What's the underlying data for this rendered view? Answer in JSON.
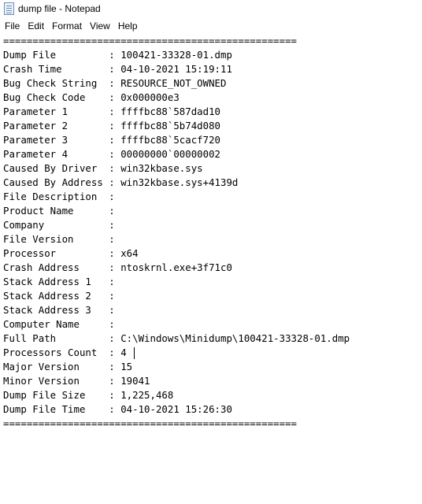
{
  "window": {
    "title": "dump file - Notepad",
    "icon": "notepad-icon"
  },
  "menu": {
    "items": [
      "File",
      "Edit",
      "Format",
      "View",
      "Help"
    ]
  },
  "editor": {
    "lines": [
      "==================================================",
      "Dump File         : 100421-33328-01.dmp",
      "Crash Time        : 04-10-2021 15:19:11",
      "Bug Check String  : RESOURCE_NOT_OWNED",
      "Bug Check Code    : 0x000000e3",
      "Parameter 1       : ffffbc88`587dad10",
      "Parameter 2       : ffffbc88`5b74d080",
      "Parameter 3       : ffffbc88`5cacf720",
      "Parameter 4       : 00000000`00000002",
      "Caused By Driver  : win32kbase.sys",
      "Caused By Address : win32kbase.sys+4139d",
      "File Description  :",
      "Product Name      :",
      "Company           :",
      "File Version      :",
      "Processor         : x64",
      "Crash Address     : ntoskrnl.exe+3f71c0",
      "Stack Address 1   :",
      "Stack Address 2   :",
      "Stack Address 3   :",
      "Computer Name     :",
      "Full Path         : C:\\Windows\\Minidump\\100421-33328-01.dmp",
      "Processors Count  : 4",
      "Major Version     : 15",
      "Minor Version     : 19041",
      "Dump File Size    : 1,225,468",
      "Dump File Time    : 04-10-2021 15:26:30",
      "=================================================="
    ]
  }
}
